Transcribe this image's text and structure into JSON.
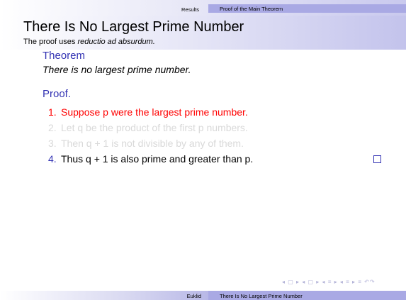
{
  "nav": {
    "section": "Results",
    "subsection": "Proof of the Main Theorem"
  },
  "frame": {
    "title": "There Is No Largest Prime Number",
    "subtitle_prefix": "The proof uses ",
    "subtitle_emph": "reductio ad absurdum."
  },
  "theorem": {
    "heading": "Theorem",
    "statement": "There is no largest prime number."
  },
  "proof": {
    "heading": "Proof.",
    "steps": [
      {
        "num": "1.",
        "text": "Suppose p were the largest prime number."
      },
      {
        "num": "2.",
        "text": "Let q be the product of the first p numbers."
      },
      {
        "num": "3.",
        "text": "Then q + 1 is not divisible by any of them."
      },
      {
        "num": "4.",
        "text": "Thus q + 1 is also prime and greater than p."
      }
    ]
  },
  "navigation_symbols": "◂ ▢ ▸ ◂ ▢ ▸ ◂ ≡ ▸ ◂ ≡ ▸ ≡ ↶↷",
  "footer": {
    "author": "Euklid",
    "short_title": "There Is No Largest Prime Number"
  },
  "colors": {
    "structure": "#3333b3",
    "alert": "#ff0000",
    "dimmed": "#d9d9d9",
    "bar": "#a9a9e4"
  }
}
